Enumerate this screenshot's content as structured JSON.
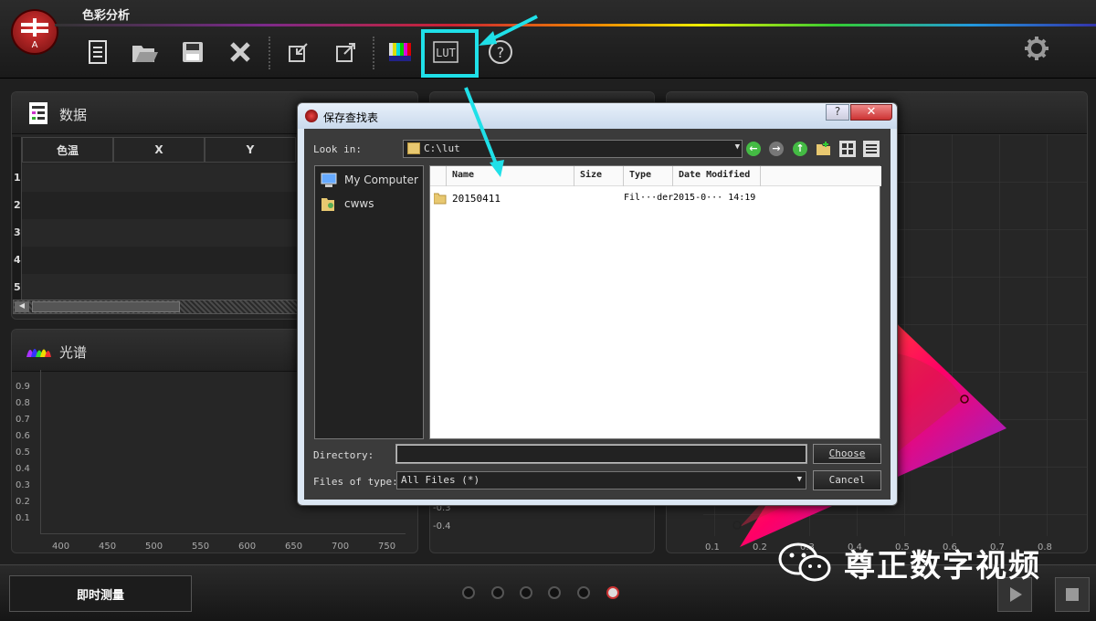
{
  "app": {
    "title": "色彩分析"
  },
  "toolbar": {
    "icons": [
      "new-document-icon",
      "open-file-icon",
      "save-icon",
      "close-icon",
      "import-icon",
      "export-icon",
      "color-bars-icon",
      "lut-icon",
      "help-icon"
    ],
    "lut_label": "LUT",
    "help_label": "?"
  },
  "data_panel": {
    "title": "数据",
    "columns": [
      "色温",
      "X",
      "Y"
    ],
    "rows": [
      "1",
      "2",
      "3",
      "4",
      "5"
    ]
  },
  "spectrum_panel": {
    "title": "光谱",
    "y_ticks": [
      "0.9",
      "0.8",
      "0.7",
      "0.6",
      "0.5",
      "0.4",
      "0.3",
      "0.2",
      "0.1"
    ],
    "x_ticks": [
      "400",
      "450",
      "500",
      "550",
      "600",
      "650",
      "700",
      "750"
    ]
  },
  "cie_panel": {
    "x_ticks": [
      "0.1",
      "0.2",
      "0.3",
      "0.4",
      "0.5",
      "0.6",
      "0.7",
      "0.8"
    ]
  },
  "middle_panel": {
    "y_ticks": [
      "-0.3",
      "-0.4"
    ]
  },
  "bottom": {
    "measure_label": "即时测量",
    "page_count": 6,
    "active_page": 6
  },
  "watermark": {
    "text": "尊正数字视频"
  },
  "dialog": {
    "title": "保存查找表",
    "help_label": "?",
    "close_label": "✕",
    "look_in_label": "Look in:",
    "look_in_value": "C:\\lut",
    "places": [
      {
        "label": "My Computer",
        "icon": "computer-icon"
      },
      {
        "label": "cwws",
        "icon": "user-folder-icon"
      }
    ],
    "file_columns": [
      "Name",
      "Size",
      "Type",
      "Date Modified"
    ],
    "files": [
      {
        "name": "20150411",
        "size": "",
        "type": "Fil···der",
        "date": "2015-0··· 14:19"
      }
    ],
    "directory_label": "Directory:",
    "directory_value": "",
    "files_of_type_label": "Files of type:",
    "files_of_type_value": "All Files (*)",
    "choose_label": "Choose",
    "cancel_label": "Cancel"
  },
  "colors": {
    "highlight": "#1fe0e8",
    "accent_red": "#cc3333"
  }
}
